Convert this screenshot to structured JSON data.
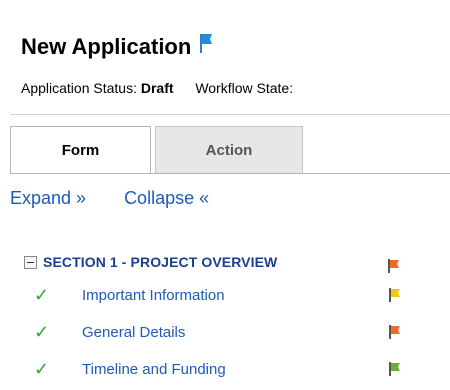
{
  "header": {
    "title": "New Application",
    "flag_color": "#1e8fd8"
  },
  "status": {
    "app_status_label": "Application Status:",
    "app_status_value": "Draft",
    "workflow_label": "Workflow State:"
  },
  "tabs": [
    {
      "label": "Form",
      "active": true
    },
    {
      "label": "Action",
      "active": false
    }
  ],
  "links": {
    "expand": "Expand »",
    "collapse": "Collapse «"
  },
  "section": {
    "title": "SECTION 1 - PROJECT OVERVIEW",
    "flag_color": "#ef6b2c"
  },
  "items": [
    {
      "label": "Important Information",
      "check": "✓",
      "flag_color": "#f5c518"
    },
    {
      "label": "General Details",
      "check": "✓",
      "flag_color": "#ef6b2c"
    },
    {
      "label": "Timeline and Funding",
      "check": "✓",
      "flag_color": "#6fae2e"
    }
  ]
}
